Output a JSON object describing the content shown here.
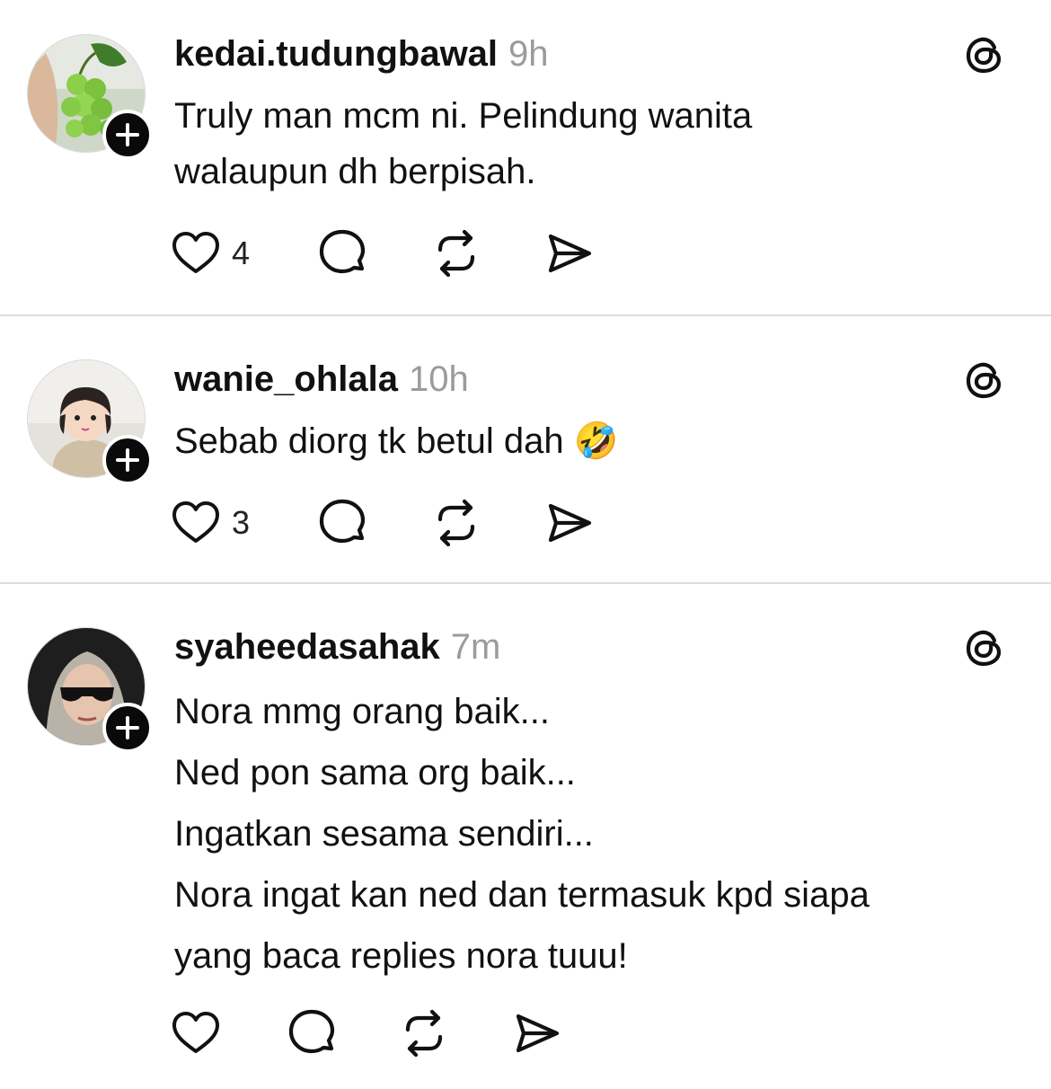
{
  "posts": [
    {
      "username": "kedai.tudungbawal",
      "time": "9h",
      "lines": [
        "Truly man mcm ni. Pelindung wanita",
        "walaupun dh berpisah."
      ],
      "likes": "4",
      "avatar": "green-fruit-photo"
    },
    {
      "username": "wanie_ohlala",
      "time": "10h",
      "lines": [
        "Sebab diorg tk betul dah 🤣"
      ],
      "likes": "3",
      "avatar": "child-photo"
    },
    {
      "username": "syaheedasahak",
      "time": "7m",
      "lines": [
        "Nora mmg orang baik...",
        "Ned pon sama org baik...",
        "Ingatkan sesama sendiri...",
        "Nora ingat kan ned dan termasuk kpd siapa",
        "yang baca replies nora tuuu!"
      ],
      "likes": "",
      "avatar": "woman-sunglasses-photo"
    }
  ],
  "icons": {
    "like": "heart-icon",
    "reply": "comment-bubble-icon",
    "repost": "repost-icon",
    "share": "send-icon",
    "brand": "threads-logo-icon",
    "follow": "plus-icon"
  },
  "colors": {
    "text": "#111111",
    "muted": "#9b9b9b",
    "divider": "#dcdcdc",
    "badge": "#0a0a0a"
  }
}
